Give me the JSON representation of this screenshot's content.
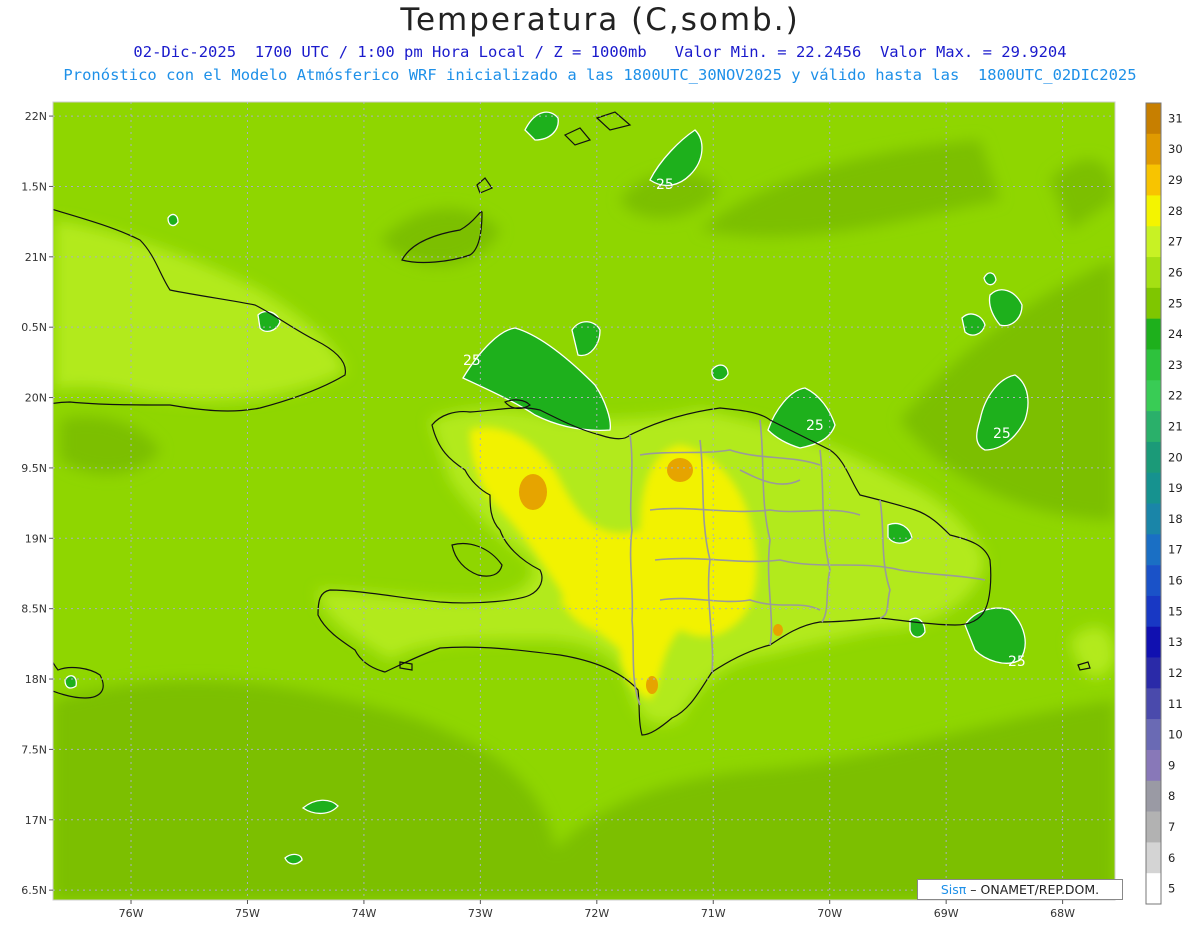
{
  "header": {
    "title": "Temperatura (C,somb.)",
    "line1": "02-Dic-2025  1700 UTC / 1:00 pm Hora Local / Z = 1000mb   Valor Min. = 22.2456  Valor Max. = 29.9204",
    "line2": "Pronóstico con el Modelo Atmósferico WRF inicializado a las 1800UTC_30NOV2025 y válido hasta las  1800UTC_02DIC2025"
  },
  "axes": {
    "lon_labels": [
      "76W",
      "75W",
      "74W",
      "73W",
      "72W",
      "71W",
      "70W",
      "69W",
      "68W"
    ],
    "lon_values": [
      -76,
      -75,
      -74,
      -73,
      -72,
      -71,
      -70,
      -69,
      -68
    ],
    "lat_labels": [
      "22N",
      "21.5N",
      "21N",
      "20.5N",
      "20N",
      "19.5N",
      "19N",
      "18.5N",
      "18N",
      "17.5N",
      "17N",
      "16.5N"
    ],
    "lat_labels_printed": [
      "22N",
      "1.5N",
      "21N",
      "0.5N",
      "20N",
      "9.5N",
      "19N",
      "8.5N",
      "18N",
      "7.5N",
      "17N",
      "6.5N"
    ],
    "lat_values": [
      22,
      21.5,
      21,
      20.5,
      20,
      19.5,
      19,
      18.5,
      18,
      17.5,
      17,
      16.5
    ],
    "lon_range": [
      -76.67,
      -67.55
    ],
    "lat_range": [
      16.43,
      22.1
    ],
    "grid": true
  },
  "colorbar": {
    "levels": [
      "31",
      "30",
      "29",
      "28",
      "27",
      "26",
      "25",
      "24",
      "23",
      "22",
      "21",
      "20",
      "19",
      "18",
      "17",
      "16",
      "15",
      "13",
      "12",
      "11",
      "10",
      "9",
      "8",
      "7",
      "6",
      "5"
    ],
    "colors": [
      "#c77f00",
      "#e09a00",
      "#f8c400",
      "#f4f400",
      "#c8f224",
      "#a5e013",
      "#7fc600",
      "#1eb01c",
      "#2ec23d",
      "#39cc55",
      "#2ab06a",
      "#1b9a78",
      "#16928f",
      "#1a85a8",
      "#1a6fc4",
      "#1a52c8",
      "#1838c4",
      "#1010b0",
      "#2a2aa8",
      "#4a4aac",
      "#6a6ab4",
      "#8878b8",
      "#9a9aa4",
      "#b2b2b2",
      "#d4d4d4",
      "#ffffff"
    ]
  },
  "contour": {
    "labels": [
      "25",
      "25",
      "25",
      "25",
      "25"
    ],
    "value": 25
  },
  "credit": {
    "sis": "Sisπ",
    "rest": "– ONAMET/REP.DOM."
  }
}
